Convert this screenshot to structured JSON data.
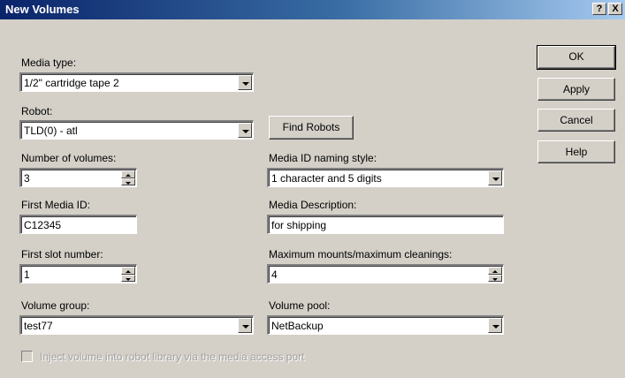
{
  "dialog": {
    "title": "New Volumes",
    "help_button": "?",
    "close_button": "X"
  },
  "fields": {
    "media_type": {
      "label": "Media type:",
      "value": "1/2\" cartridge tape 2"
    },
    "robot": {
      "label": "Robot:",
      "value": "TLD(0) - atl"
    },
    "num_volumes": {
      "label": "Number of volumes:",
      "value": "3"
    },
    "naming_style": {
      "label": "Media ID naming style:",
      "value": "1 character  and 5 digits"
    },
    "first_media_id": {
      "label": "First Media ID:",
      "value": "C12345"
    },
    "media_description": {
      "label": "Media Description:",
      "value": "for shipping"
    },
    "first_slot": {
      "label": "First slot number:",
      "value": "1"
    },
    "max_mounts": {
      "label": "Maximum mounts/maximum cleanings:",
      "value": "4"
    },
    "volume_group": {
      "label": "Volume group:",
      "value": "test77"
    },
    "volume_pool": {
      "label": "Volume pool:",
      "value": "NetBackup"
    }
  },
  "buttons": {
    "find_robots": "Find Robots",
    "ok": "OK",
    "apply": "Apply",
    "cancel": "Cancel",
    "help": "Help"
  },
  "inject": {
    "label": "Inject volume into robot library via the media access port",
    "checked": false
  }
}
